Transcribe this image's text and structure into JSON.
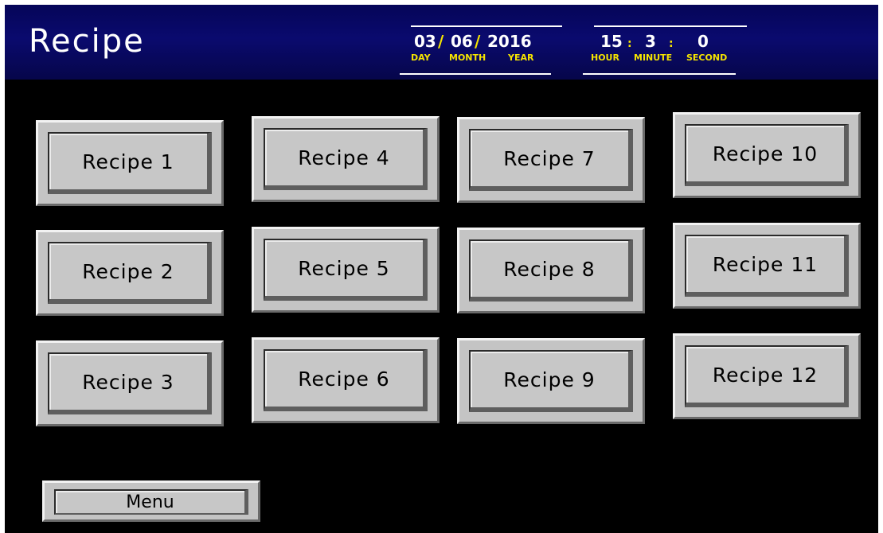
{
  "header": {
    "title": "Recipe",
    "date": {
      "day": "03",
      "month": "06",
      "year": "2016",
      "separator": "/",
      "day_label": "DAY",
      "month_label": "MONTH",
      "year_label": "YEAR"
    },
    "time": {
      "hour": "15",
      "minute": "3",
      "second": "0",
      "separator": ":",
      "hour_label": "HOUR",
      "minute_label": "MINUTE",
      "second_label": "SECOND"
    }
  },
  "recipes": [
    {
      "label": "Recipe 1"
    },
    {
      "label": "Recipe 2"
    },
    {
      "label": "Recipe 3"
    },
    {
      "label": "Recipe 4"
    },
    {
      "label": "Recipe 5"
    },
    {
      "label": "Recipe 6"
    },
    {
      "label": "Recipe 7"
    },
    {
      "label": "Recipe 8"
    },
    {
      "label": "Recipe 9"
    },
    {
      "label": "Recipe 10"
    },
    {
      "label": "Recipe 11"
    },
    {
      "label": "Recipe 12"
    }
  ],
  "footer": {
    "menu_label": "Menu"
  },
  "colors": {
    "header_bg": "#0a0a6e",
    "background": "#000000",
    "button_face": "#c7c7c7",
    "label_accent": "#f5e400",
    "text_light": "#ffffff"
  }
}
